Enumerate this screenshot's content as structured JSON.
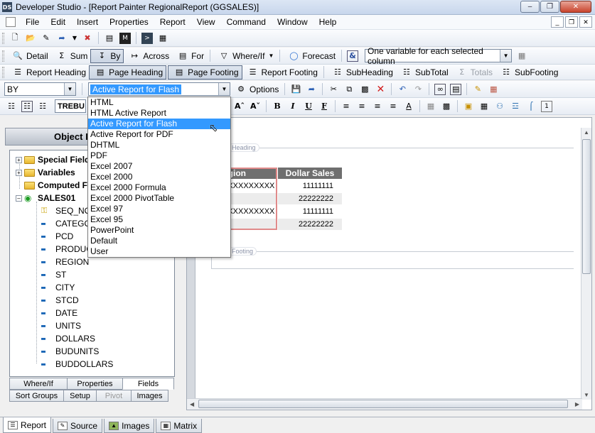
{
  "window": {
    "title": "Developer Studio - [Report Painter RegionalReport (GGSALES)]",
    "icon_label": "DS"
  },
  "menubar": {
    "items": [
      "File",
      "Edit",
      "Insert",
      "Properties",
      "Report",
      "View",
      "Command",
      "Window",
      "Help"
    ]
  },
  "toolbar_fields": {
    "detail": "Detail",
    "sum": "Sum",
    "by": "By",
    "across": "Across",
    "for": "For",
    "where_if": "Where/If",
    "forecast": "Forecast",
    "column_mode": "One variable for each selected column"
  },
  "toolbar_sections": {
    "report_heading": "Report Heading",
    "page_heading": "Page Heading",
    "page_footing": "Page Footing",
    "report_footing": "Report Footing",
    "subheading": "SubHeading",
    "subtotal": "SubTotal",
    "totals": "Totals",
    "subfooting": "SubFooting"
  },
  "toolbar_format": {
    "sort_combo": "BY",
    "output_format": "Active Report for Flash",
    "options": "Options",
    "font_combo": "TREBU"
  },
  "dropdown": {
    "selected": "Active Report for Flash",
    "options": [
      "HTML",
      "HTML Active Report",
      "Active Report for Flash",
      "Active Report for PDF",
      "DHTML",
      "PDF",
      "Excel 2007",
      "Excel 2000",
      "Excel 2000 Formula",
      "Excel 2000 PivotTable",
      "Excel 97",
      "Excel 95",
      "PowerPoint",
      "Default",
      "User"
    ]
  },
  "object_panel": {
    "header": "Object I",
    "groups": [
      "Special Field",
      "Variables",
      "Computed F"
    ],
    "source": "SALES01",
    "fields": [
      "SEQ_NO",
      "CATEGO",
      "PCD",
      "PRODUC",
      "REGION",
      "ST",
      "CITY",
      "STCD",
      "DATE",
      "UNITS",
      "DOLLARS",
      "BUDUNITS",
      "BUDDOLLARS"
    ],
    "tabs_row1": [
      "Where/If",
      "Properties",
      "Fields"
    ],
    "tabs_row2": [
      "Sort Groups",
      "Setup",
      "Pivot",
      "Images"
    ]
  },
  "report_canvas": {
    "heading_tag": "Heading",
    "footing_tag": "Footing",
    "columns": [
      "egion",
      "Dollar Sales"
    ],
    "rows": [
      {
        "region": "XXXXXXXXXX",
        "sales": "11111111"
      },
      {
        "region": "",
        "sales": "22222222"
      },
      {
        "region": "XXXXXXXXXX",
        "sales": "11111111"
      },
      {
        "region": "",
        "sales": "22222222"
      }
    ]
  },
  "bottom_tabs": [
    "Report",
    "Source",
    "Images",
    "Matrix"
  ]
}
